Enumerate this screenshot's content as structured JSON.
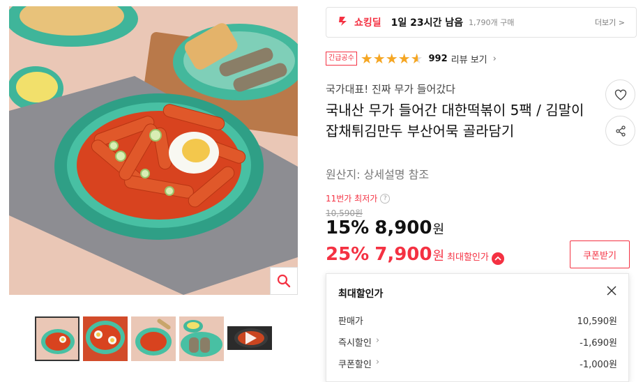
{
  "product_gallery": {
    "thumbnail_count": 5
  },
  "shocking_deal": {
    "label": "쇼킹딜",
    "time_left": "1일 23시간 남음",
    "purchase_count": "1,790개 구매",
    "more_label": "더보기 >"
  },
  "rating": {
    "badge": "긴급공수",
    "stars": 4.5,
    "review_count": "992",
    "review_label": "리뷰 보기"
  },
  "product": {
    "subtitle": "국가대표! 진짜 무가 들어갔다",
    "title": "국내산 무가 들어간 대한떡볶이 5팩 / 김말이 잡채튀김만두 부산어묵 골라담기",
    "origin": "원산지: 상세설명 참조"
  },
  "pricing": {
    "lowest_label": "11번가 최저가",
    "original_price": "10,590원",
    "discount1_percent": "15%",
    "discount1_price": "8,900",
    "discount2_percent": "25%",
    "discount2_price": "7,900",
    "won": "원",
    "max_discount_label": "최대할인가",
    "coupon_button": "쿠폰받기"
  },
  "max_discount_popup": {
    "title": "최대할인가",
    "rows": [
      {
        "label": "판매가",
        "value": "10,590원"
      },
      {
        "label": "즉시할인",
        "value": "-1,690원"
      },
      {
        "label": "쿠폰할인",
        "value": "-1,000원"
      }
    ]
  },
  "colors": {
    "accent_red": "#f43142",
    "star": "#f5a623"
  }
}
